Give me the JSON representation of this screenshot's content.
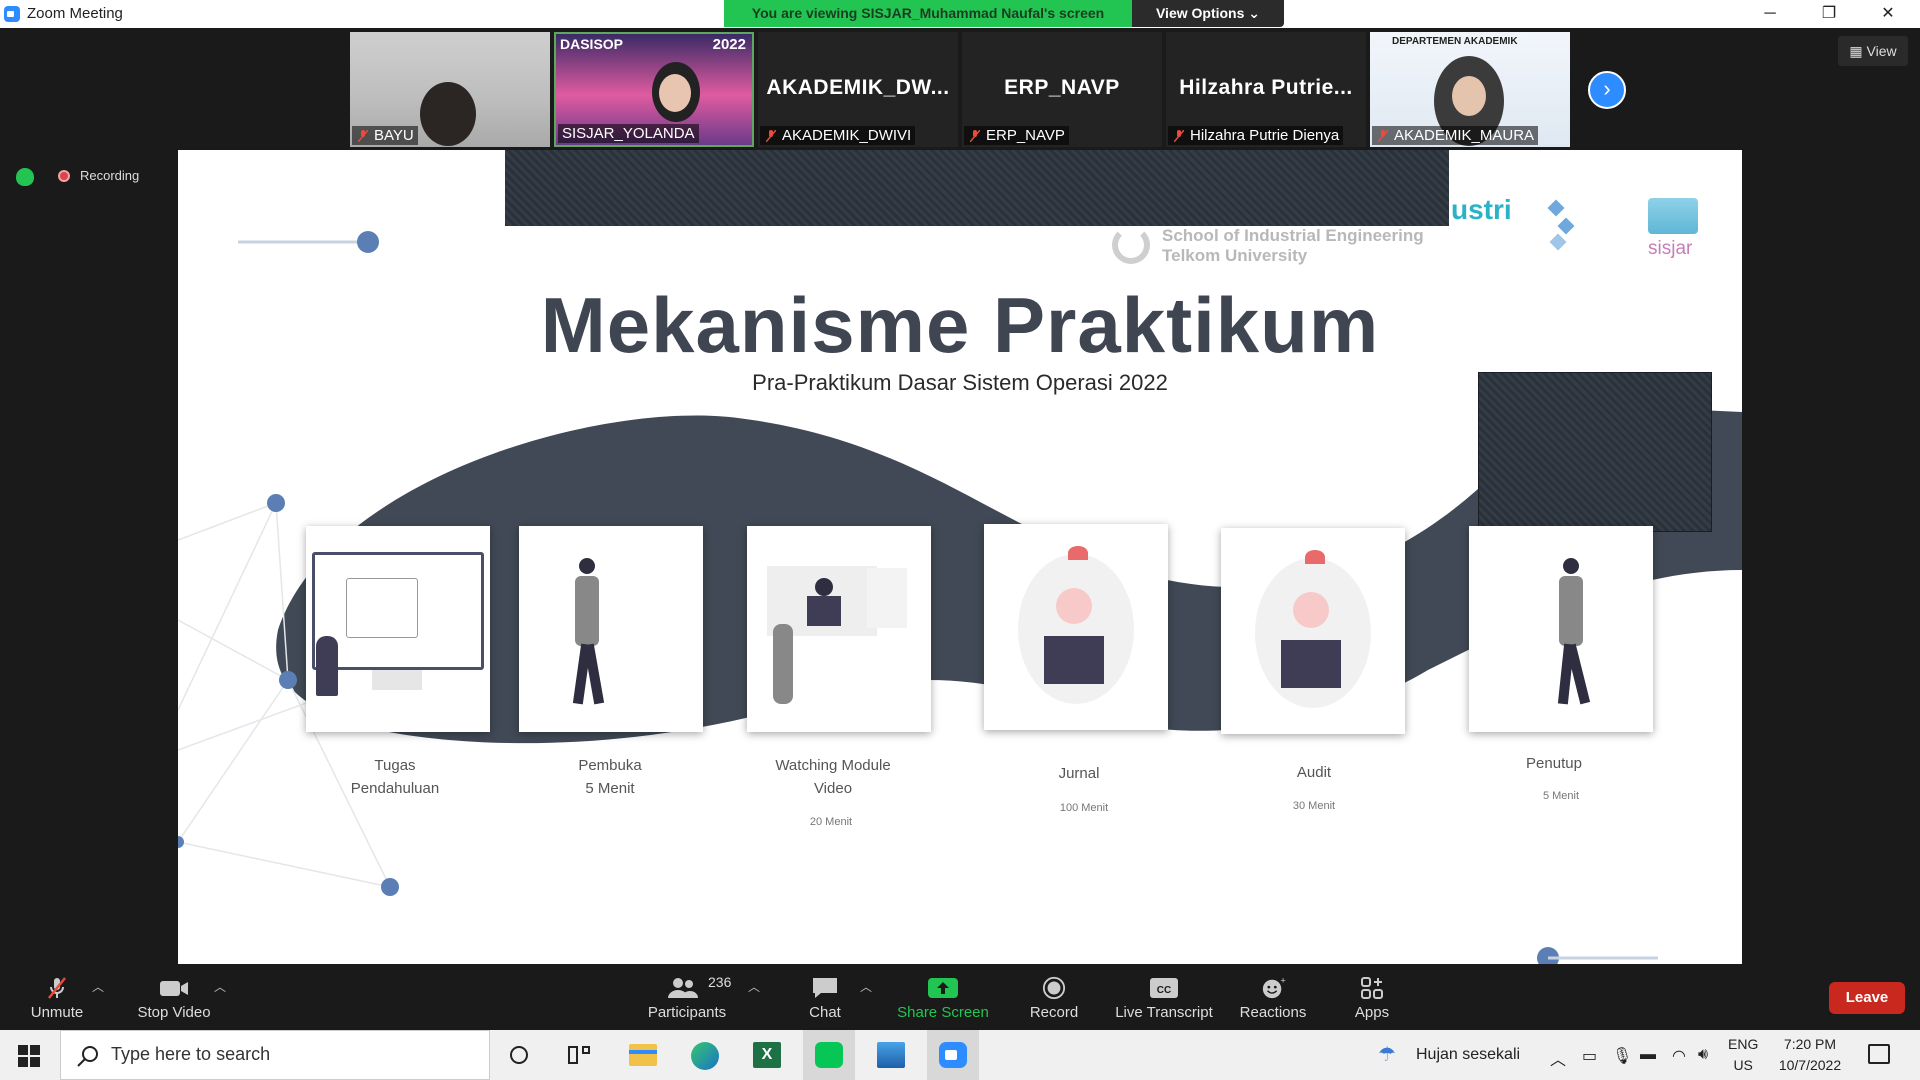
{
  "window": {
    "title": "Zoom Meeting",
    "share_banner": "You are viewing SISJAR_Muhammad Naufal's screen",
    "view_options": "View Options",
    "minimize": "─",
    "restore": "❐",
    "close": "✕"
  },
  "participants": [
    {
      "name": "BAYU",
      "video": true
    },
    {
      "name": "SISJAR_YOLANDA",
      "video": true,
      "overlay_left": "DASISOP",
      "overlay_right": "2022"
    },
    {
      "name": "AKADEMIK_DWIVI",
      "display": "AKADEMIK_DW..."
    },
    {
      "name": "ERP_NAVP",
      "display": "ERP_NAVP"
    },
    {
      "name": "Hilzahra Putrie Dienya",
      "display": "Hilzahra  Putrie..."
    },
    {
      "name": "AKADEMIK_MAURA",
      "video": true,
      "overlay_top": "DEPARTEMEN AKADEMIK"
    }
  ],
  "view_button": "View",
  "recording_label": "Recording",
  "slide": {
    "title": "Mekanisme Praktikum",
    "subtitle": "Pra-Praktikum Dasar Sistem Operasi 2022",
    "logo_school_line1": "School of Industrial Engineering",
    "logo_school_line2": "Telkom University",
    "logo_partial": "ustri",
    "logo_sisjar": "sisjar",
    "steps": [
      {
        "label1": "Tugas",
        "label2": "Pendahuluan",
        "sub": ""
      },
      {
        "label1": "Pembuka",
        "label2": "5 Menit",
        "sub": ""
      },
      {
        "label1": "Watching Module",
        "label2": "Video",
        "sub": "20 Menit"
      },
      {
        "label1": "Jurnal",
        "label2": "",
        "sub": "100 Menit"
      },
      {
        "label1": "Audit",
        "label2": "",
        "sub": "30 Menit"
      },
      {
        "label1": "Penutup",
        "label2": "",
        "sub": "5 Menit"
      }
    ]
  },
  "toolbar": {
    "unmute": "Unmute",
    "stop_video": "Stop Video",
    "participants": "Participants",
    "participants_count": "236",
    "chat": "Chat",
    "share_screen": "Share Screen",
    "record": "Record",
    "live_transcript": "Live Transcript",
    "reactions": "Reactions",
    "apps": "Apps",
    "leave": "Leave",
    "accent_green": "#23c552",
    "leave_color": "#c8281e"
  },
  "taskbar": {
    "search_placeholder": "Type here to search",
    "weather": "Hujan sesekali",
    "lang_top": "ENG",
    "lang_bottom": "US",
    "time": "7:20 PM",
    "date": "10/7/2022"
  }
}
